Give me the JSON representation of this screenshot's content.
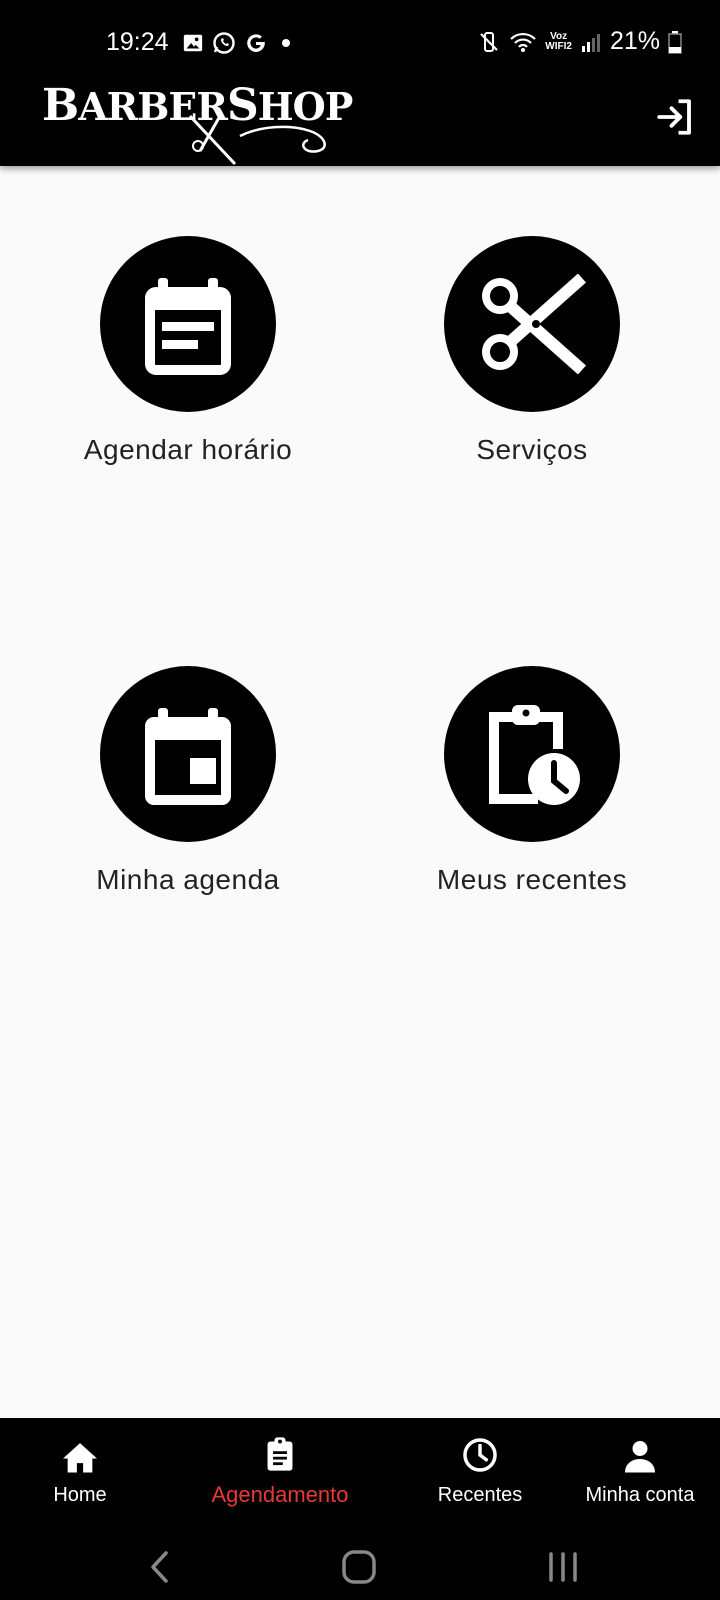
{
  "status": {
    "time": "19:24",
    "battery": "21%",
    "voz_line1": "Voz",
    "voz_line2": "WIFI2"
  },
  "appbar": {
    "logo_text_b": "B",
    "logo_text_arber": "ARBER",
    "logo_text_s": "S",
    "logo_text_hop": "HOP",
    "exit_icon": "login-icon"
  },
  "menu": {
    "items": [
      {
        "label": "Agendar horário",
        "icon": "calendar-note-icon"
      },
      {
        "label": "Serviços",
        "icon": "scissors-icon"
      },
      {
        "label": "Minha agenda",
        "icon": "calendar-event-icon"
      },
      {
        "label": "Meus recentes",
        "icon": "clipboard-clock-icon"
      }
    ]
  },
  "bottom_nav": {
    "items": [
      {
        "label": "Home",
        "icon": "home-icon"
      },
      {
        "label": "Agendamento",
        "icon": "assignment-icon"
      },
      {
        "label": "Recentes",
        "icon": "clock-icon"
      },
      {
        "label": "Minha conta",
        "icon": "person-icon"
      }
    ],
    "active_color": "#e53b35"
  }
}
